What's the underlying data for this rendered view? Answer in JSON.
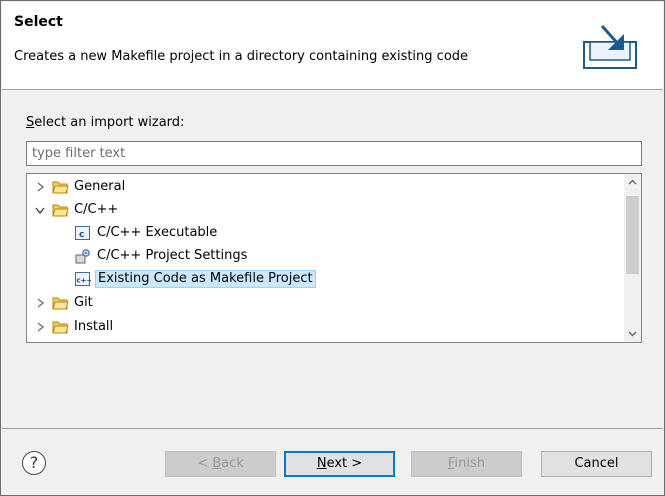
{
  "header": {
    "title": "Select",
    "description": "Creates a new Makefile project in a directory containing existing code"
  },
  "wizard": {
    "label_mnemonic": "S",
    "label_rest": "elect an import wizard:",
    "filter_placeholder": "type filter text",
    "filter_value": ""
  },
  "tree": {
    "items": [
      {
        "label": "General",
        "icon": "folder-icon",
        "expanded": false,
        "level": 0
      },
      {
        "label": "C/C++",
        "icon": "folder-icon",
        "expanded": true,
        "level": 0
      },
      {
        "label": "C/C++ Executable",
        "icon": "c-file-icon",
        "level": 1
      },
      {
        "label": "C/C++ Project Settings",
        "icon": "settings-icon",
        "level": 1
      },
      {
        "label": "Existing Code as Makefile Project",
        "icon": "cpp-project-icon",
        "level": 1,
        "selected": true
      },
      {
        "label": "Git",
        "icon": "folder-icon",
        "expanded": false,
        "level": 0
      },
      {
        "label": "Install",
        "icon": "folder-icon",
        "expanded": false,
        "level": 0
      }
    ]
  },
  "buttons": {
    "back_mnemonic": "B",
    "back_prefix": "< ",
    "back_rest": "ack",
    "next_mnemonic": "N",
    "next_rest": "ext >",
    "finish_mnemonic": "F",
    "finish_rest": "inish",
    "cancel": "Cancel"
  },
  "colors": {
    "selection_bg": "#cce8ff",
    "primary_border": "#0078d7",
    "folder": "#e8b64a"
  }
}
